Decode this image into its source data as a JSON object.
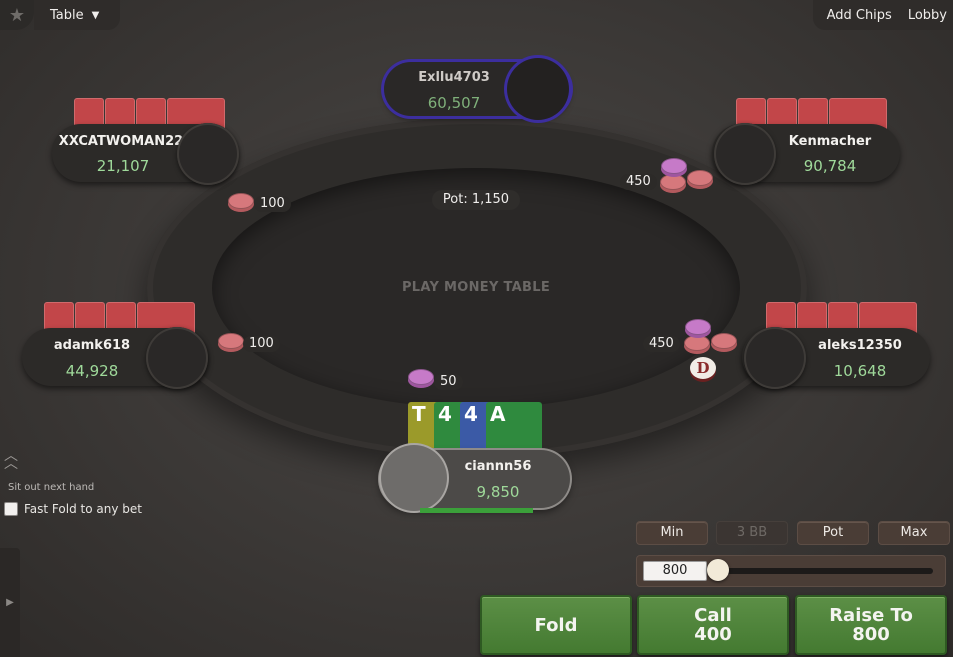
{
  "topbar": {
    "table_menu": "Table",
    "add_chips": "Add Chips",
    "lobby": "Lobby"
  },
  "table": {
    "label": "PLAY MONEY TABLE",
    "pot": "Pot: 1,150"
  },
  "players": {
    "top": {
      "name": "Exllu4703",
      "stack": "60,507",
      "active": true
    },
    "upper_left": {
      "name": "XXCATWOMAN22",
      "stack": "21,107"
    },
    "upper_right": {
      "name": "Kenmacher",
      "stack": "90,784"
    },
    "mid_left": {
      "name": "adamk618",
      "stack": "44,928"
    },
    "mid_right": {
      "name": "aleks12350",
      "stack": "10,648"
    },
    "hero": {
      "name": "ciannn56",
      "stack": "9,850"
    }
  },
  "bets": {
    "upper_left": "100",
    "upper_right": "450",
    "mid_left": "100",
    "mid_right": "450",
    "hero": "50"
  },
  "dealer_button": "D",
  "hero_cards": [
    {
      "rank": "T",
      "color": "#9b9a2a"
    },
    {
      "rank": "4",
      "color": "#2f8a3e"
    },
    {
      "rank": "4",
      "color": "#3b5aa6"
    },
    {
      "rank": "A",
      "color": "#2f8a3e"
    }
  ],
  "controls": {
    "sit_out": "Sit out next hand",
    "fast_fold": "Fast Fold to any bet",
    "presets": {
      "min": "Min",
      "three_bb": "3 BB",
      "pot": "Pot",
      "max": "Max"
    },
    "bet_amount": "800",
    "fold": "Fold",
    "call_label": "Call",
    "call_amount": "400",
    "raise_label": "Raise To",
    "raise_amount": "800"
  },
  "colors": {
    "action_green": "#4f8a3a",
    "active_ring": "#3c2e9e",
    "stack_green": "#9fd99a",
    "card_back": "#c24649"
  }
}
